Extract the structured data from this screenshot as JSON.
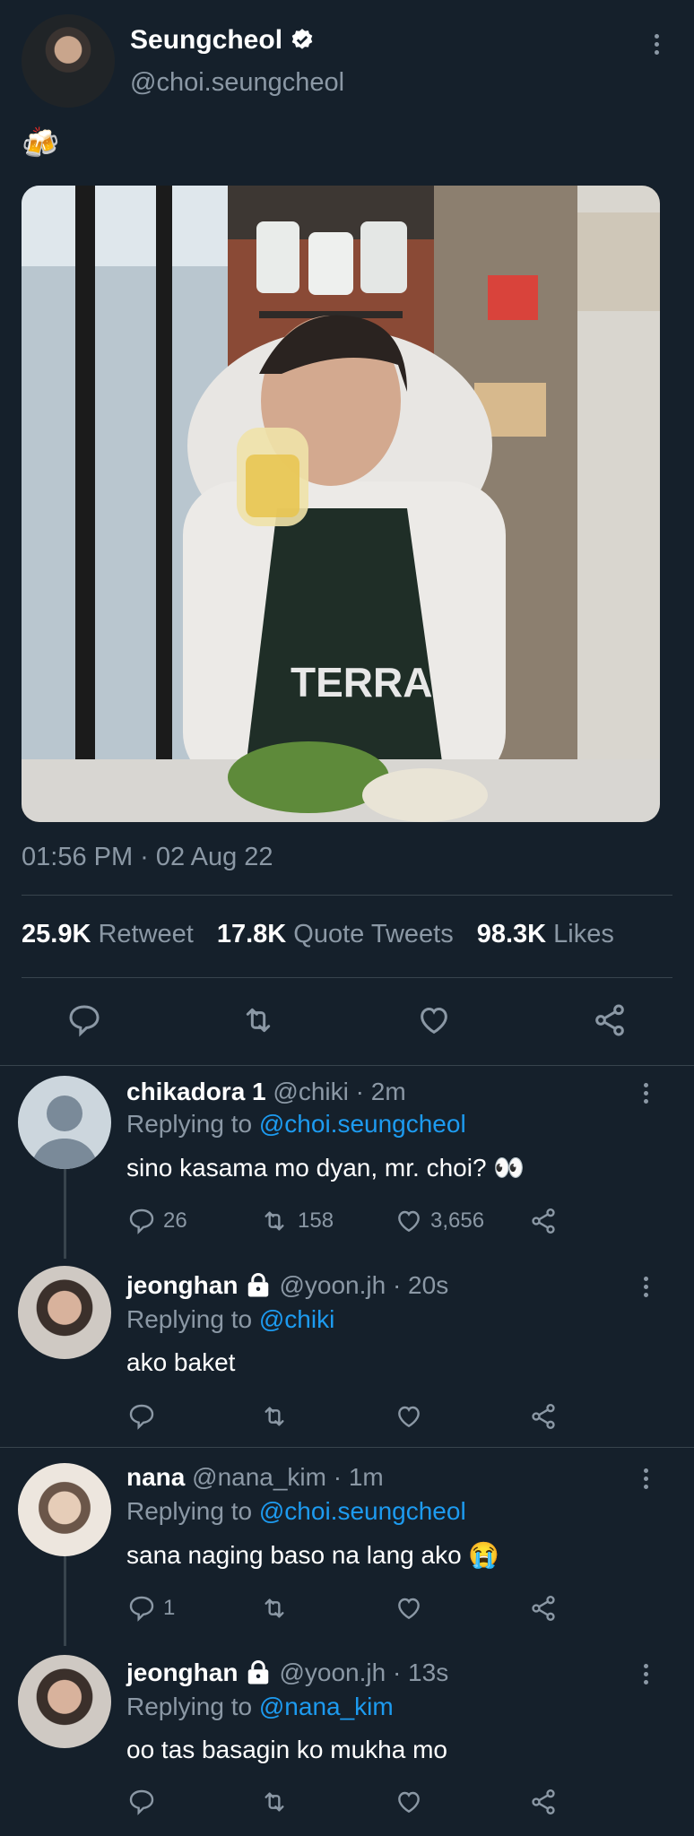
{
  "post": {
    "display_name": "Seungcheol",
    "verified_icon": "verified-badge-icon",
    "handle": "@choi.seungcheol",
    "text": "🍻",
    "timestamp": "01:56 PM · 02 Aug 22",
    "stats": {
      "retweets_count": "25.9K",
      "retweets_label": "Retweet",
      "quotes_count": "17.8K",
      "quotes_label": "Quote Tweets",
      "likes_count": "98.3K",
      "likes_label": "Likes"
    }
  },
  "replies": [
    {
      "name": "chikadora 1",
      "meta": "@chiki · 2m",
      "replying_prefix": "Replying to",
      "replying_to": "@choi.seungcheol",
      "text": "sino kasama mo dyan, mr. choi? 👀",
      "counts": {
        "reply": "26",
        "retweet": "158",
        "like": "3,656"
      }
    },
    {
      "name": "jeonghan",
      "meta": "@yoon.jh · 20s",
      "replying_prefix": "Replying to",
      "replying_to": "@chiki",
      "text": "ako baket",
      "counts": {
        "reply": "",
        "retweet": "",
        "like": ""
      }
    },
    {
      "name": "nana",
      "meta": "@nana_kim · 1m",
      "replying_prefix": "Replying to",
      "replying_to": "@choi.seungcheol",
      "text": "sana naging baso na lang ako 😭",
      "counts": {
        "reply": "1",
        "retweet": "",
        "like": ""
      }
    },
    {
      "name": "jeonghan",
      "meta": "@yoon.jh · 13s",
      "replying_prefix": "Replying to",
      "replying_to": "@nana_kim",
      "text": "oo tas basagin ko mukha mo",
      "counts": {
        "reply": "",
        "retweet": "",
        "like": ""
      }
    }
  ],
  "colors": {
    "background": "#15202b",
    "text_muted": "#8b98a5",
    "link": "#1d9bf0",
    "divider": "#38444d"
  }
}
